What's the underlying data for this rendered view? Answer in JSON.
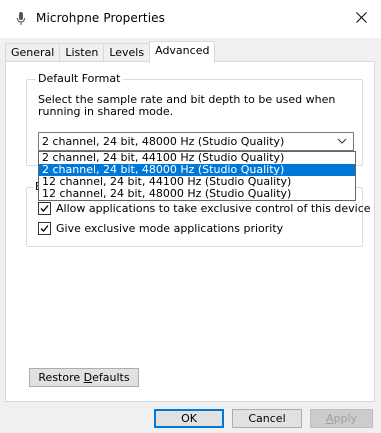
{
  "window": {
    "title": "Microhpne Properties"
  },
  "tabs": [
    {
      "label": "General",
      "active": false
    },
    {
      "label": "Listen",
      "active": false
    },
    {
      "label": "Levels",
      "active": false
    },
    {
      "label": "Advanced",
      "active": true
    }
  ],
  "default_format": {
    "legend": "Default Format",
    "description": "Select the sample rate and bit depth to be used when running in shared mode.",
    "selected_value": "2 channel, 24 bit, 48000 Hz (Studio Quality)",
    "options": [
      "2 channel, 24 bit, 44100 Hz (Studio Quality)",
      "2 channel, 24 bit, 48000 Hz (Studio Quality)",
      "12 channel, 24 bit, 44100 Hz (Studio Quality)",
      "12 channel, 24 bit, 48000 Hz (Studio Quality)"
    ],
    "highlighted_index": 1
  },
  "exclusive_mode": {
    "legend_visible": "E",
    "allow_exclusive": {
      "label": "Allow applications to take exclusive control of this device",
      "checked": true
    },
    "give_priority": {
      "label": "Give exclusive mode applications priority",
      "checked": true
    }
  },
  "buttons": {
    "restore_prefix": "Restore ",
    "restore_accel": "D",
    "restore_suffix": "efaults",
    "ok": "OK",
    "cancel": "Cancel",
    "apply_accel": "A",
    "apply_suffix": "pply"
  },
  "colors": {
    "selection": "#0078d7",
    "accent_border": "#0078d7"
  }
}
